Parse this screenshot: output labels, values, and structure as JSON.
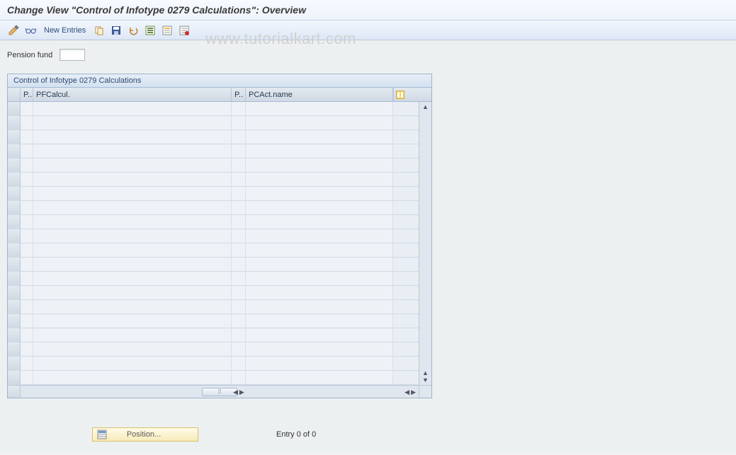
{
  "header": {
    "title": "Change View \"Control of Infotype 0279 Calculations\": Overview"
  },
  "toolbar": {
    "new_entries_label": "New Entries"
  },
  "watermark": "www.tutorialkart.com",
  "form": {
    "pension_fund_label": "Pension fund",
    "pension_fund_value": ""
  },
  "table": {
    "title": "Control of Infotype 0279 Calculations",
    "columns": {
      "p1": "P..",
      "pfcalcul": "PFCalcul.",
      "p2": "P..",
      "pcact": "PCAct.name"
    },
    "row_count": 20
  },
  "footer": {
    "position_label": "Position...",
    "entry_status": "Entry 0 of 0"
  }
}
